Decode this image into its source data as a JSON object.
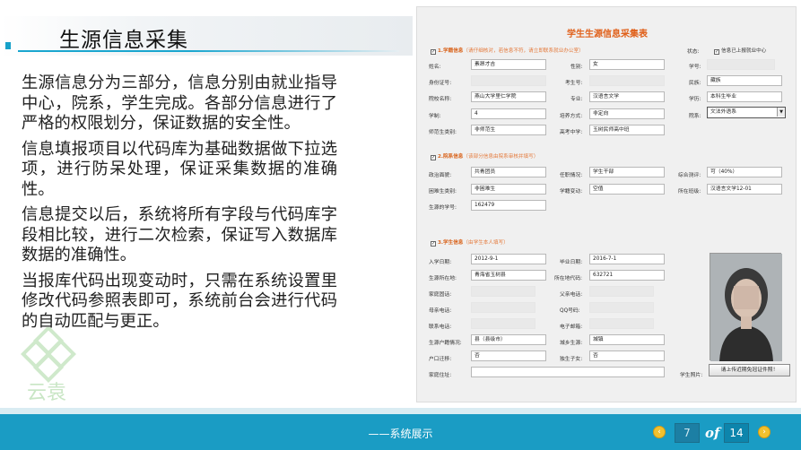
{
  "slide": {
    "title": "生源信息采集",
    "paragraphs": [
      "生源信息分为三部分，信息分别由就业指导中心，院系，学生完成。各部分信息进行了严格的权限划分，保证数据的安全性。",
      "信息填报项目以代码库为基础数据做下拉选项，进行防呆处理，保证采集数据的准确性。",
      "信息提交以后，系统将所有字段与代码库字段相比较，进行二次检索，保证写入数据库数据的准确性。",
      "当报库代码出现变动时，只需在系统设置里修改代码参照表即可，系统前台会进行代码的自动匹配与更正。"
    ],
    "logo_text": "云袁"
  },
  "form": {
    "title": "学生生源信息采集表",
    "sections": {
      "s1": {
        "title": "1.学籍信息",
        "note": "（请仔细核对，若信息不符，请立即联系就业办公室）"
      },
      "s2": {
        "title": "2.院系信息",
        "note": "（该部分信息由院系审核并填写）"
      },
      "s3": {
        "title": "3.学生信息",
        "note": "（由学生本人填写）"
      }
    },
    "status_label": "状态:",
    "status_checkbox_label": "信息已上报就业中心",
    "fields": {
      "name_l": "姓名:",
      "name_v": "素昂才吉",
      "gender_l": "性别:",
      "gender_v": "女",
      "sid_l": "学号:",
      "sid_v": "",
      "idcard_l": "身份证号:",
      "idcard_v": "",
      "examno_l": "考生号:",
      "examno_v": "",
      "ethnic_l": "民族:",
      "ethnic_v": "藏族",
      "school_l": "院校名称:",
      "school_v": "燕山大学里仁学院",
      "major_l": "专业:",
      "major_v": "汉语言文学",
      "edu_l": "学历:",
      "edu_v": "本科生毕业",
      "years_l": "学制:",
      "years_v": "4",
      "train_l": "培养方式:",
      "train_v": "非定向",
      "dept_l": "院系:",
      "dept_v": "文法外语系",
      "normal_l": "师范生类别:",
      "normal_v": "非师范生",
      "hs_l": "高考中学:",
      "hs_v": "玉树民师高中班",
      "pol_l": "政治面貌:",
      "pol_v": "共青团员",
      "duty_l": "任职情况:",
      "duty_v": "学生干部",
      "score_l": "综合测评:",
      "score_v": "可（40%）",
      "poor_l": "困难生类别:",
      "poor_v": "非困难生",
      "change_l": "学籍变动:",
      "change_v": "空值",
      "class_l": "所在班级:",
      "class_v": "汉语言文学12-01",
      "stuno_l": "生源的学号:",
      "stuno_v": "162479",
      "enroll_l": "入学日期:",
      "enroll_v": "2012-9-1",
      "grad_l": "毕业日期:",
      "grad_v": "2016-7-1",
      "origin_l": "生源所在地:",
      "origin_v": "青海省玉树县",
      "areacode_l": "所在地代码:",
      "areacode_v": "632721",
      "homephone_l": "家庭固话:",
      "homephone_v": "",
      "fatherphone_l": "父亲电话:",
      "fatherphone_v": "",
      "motherphone_l": "母亲电话:",
      "motherphone_v": "",
      "qq_l": "QQ号码:",
      "qq_v": "",
      "phone_l": "联系电话:",
      "phone_v": "",
      "email_l": "电子邮箱:",
      "email_v": "",
      "hukou_l": "生源户籍情况:",
      "hukou_v": "县（县级市）",
      "urban_l": "城乡生源:",
      "urban_v": "城镇",
      "hukoumove_l": "户口迁移:",
      "hukoumove_v": "否",
      "onlychild_l": "独生子女:",
      "onlychild_v": "否",
      "address_l": "家庭住址:",
      "address_v": "",
      "photo_l": "学生照片:"
    },
    "upload_button": "请上传近期免冠证件照！"
  },
  "footer": {
    "label": "——系统展示",
    "prev_icon": "‹",
    "next_icon": "›",
    "current_page": "7",
    "of_label": "of",
    "total_pages": "14"
  },
  "colors": {
    "accent": "#1a9cc4",
    "section": "#d9631b",
    "nav": "#f2c12e"
  }
}
